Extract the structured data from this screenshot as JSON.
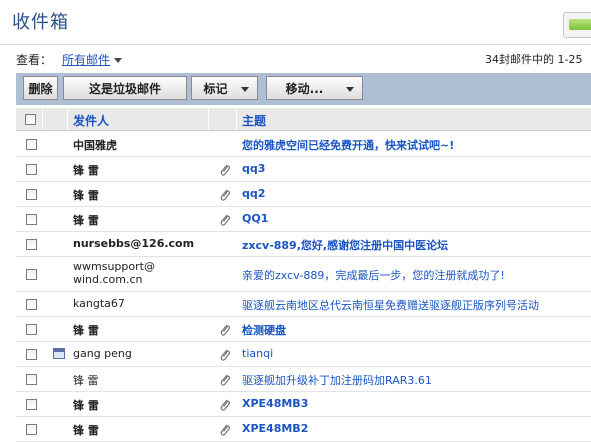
{
  "page": {
    "title": "收件箱"
  },
  "view": {
    "label": "查看：",
    "selected": "所有邮件",
    "count_text": "34封邮件中的 1-25"
  },
  "toolbar": {
    "delete": "删除",
    "spam": "这是垃圾邮件",
    "mark": "标记",
    "move": "移动..."
  },
  "columns": {
    "sender": "发件人",
    "subject": "主题"
  },
  "rows": [
    {
      "sender": "中国雅虎",
      "subject": "您的雅虎空间已经免费开通，快来试试吧~!",
      "bold": true,
      "attach": false,
      "cal": false
    },
    {
      "sender": "锋 雷",
      "subject": "qq3",
      "bold": true,
      "attach": true,
      "cal": false
    },
    {
      "sender": "锋 雷",
      "subject": "qq2",
      "bold": true,
      "attach": true,
      "cal": false
    },
    {
      "sender": "锋 雷",
      "subject": "QQ1",
      "bold": true,
      "attach": true,
      "cal": false
    },
    {
      "sender": "nursebbs@126.com",
      "subject": "zxcv-889,您好,感谢您注册中国中医论坛",
      "bold": true,
      "attach": false,
      "cal": false
    },
    {
      "sender": "wwmsupport@ wind.com.cn",
      "subject": "亲爱的zxcv-889，完成最后一步，您的注册就成功了!",
      "bold": false,
      "attach": false,
      "cal": false
    },
    {
      "sender": "kangta67",
      "subject": "驱逐舰云南地区总代云南恒星免费赠送驱逐舰正版序列号活动",
      "bold": false,
      "attach": false,
      "cal": false
    },
    {
      "sender": "锋 雷",
      "subject": "检测硬盘",
      "bold": true,
      "attach": true,
      "cal": false
    },
    {
      "sender": "gang peng",
      "subject": "tianqi",
      "bold": false,
      "attach": true,
      "cal": true
    },
    {
      "sender": "锋 雷",
      "subject": "驱逐舰加升级补丁加注册码加RAR3.61",
      "bold": false,
      "attach": true,
      "cal": false
    },
    {
      "sender": "锋 雷",
      "subject": "XPE48MB3",
      "bold": true,
      "attach": true,
      "cal": false
    },
    {
      "sender": "锋 雷",
      "subject": "XPE48MB2",
      "bold": true,
      "attach": true,
      "cal": false
    }
  ]
}
